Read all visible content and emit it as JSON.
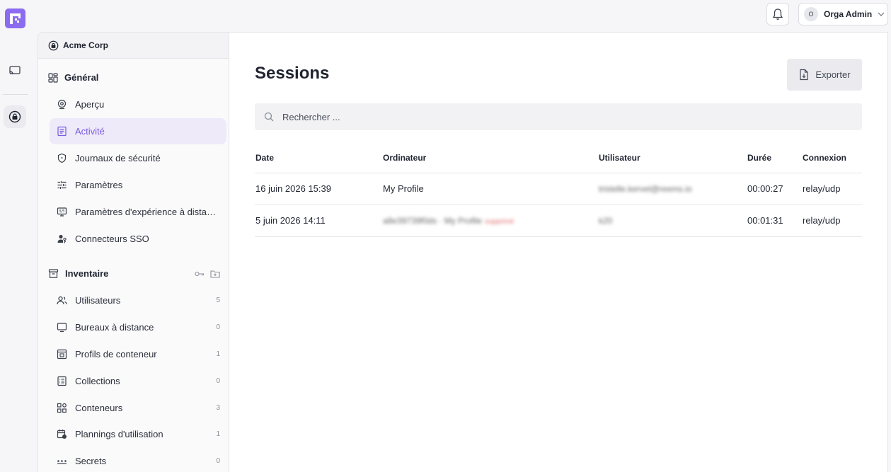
{
  "topbar": {
    "user_initial": "O",
    "user_name": "Orga Admin"
  },
  "sidebar": {
    "org_name": "Acme Corp",
    "general": {
      "title": "Général",
      "items": [
        {
          "label": "Aperçu"
        },
        {
          "label": "Activité"
        },
        {
          "label": "Journaux de sécurité"
        },
        {
          "label": "Paramètres"
        },
        {
          "label": "Paramètres d'expérience à distance"
        },
        {
          "label": "Connecteurs SSO"
        }
      ]
    },
    "inventory": {
      "title": "Inventaire",
      "items": [
        {
          "label": "Utilisateurs",
          "count": "5"
        },
        {
          "label": "Bureaux à distance",
          "count": "0"
        },
        {
          "label": "Profils de conteneur",
          "count": "1"
        },
        {
          "label": "Collections",
          "count": "0"
        },
        {
          "label": "Conteneurs",
          "count": "3"
        },
        {
          "label": "Plannings d'utilisation",
          "count": "1"
        },
        {
          "label": "Secrets",
          "count": "0"
        }
      ]
    }
  },
  "main": {
    "title": "Sessions",
    "export_label": "Exporter",
    "search_placeholder": "Rechercher ...",
    "columns": [
      "Date",
      "Ordinateur",
      "Utilisateur",
      "Durée",
      "Connexion"
    ],
    "rows": [
      {
        "date": "16 juin 2026 15:39",
        "computer": "My Profile",
        "user": "tristelle.kervel@reems.io",
        "duration": "00:00:27",
        "connection": "relay/udp"
      },
      {
        "date": "5 juin 2026 14:11",
        "computer": "a8e39739f0ds · My Profile",
        "computer_tag": "supprimé",
        "user": "k20",
        "duration": "00:01:31",
        "connection": "relay/udp"
      }
    ]
  },
  "colors": {
    "accent": "#8b6cf0",
    "active_bg": "#eeeaf9",
    "active_text": "#7a5ae0"
  }
}
